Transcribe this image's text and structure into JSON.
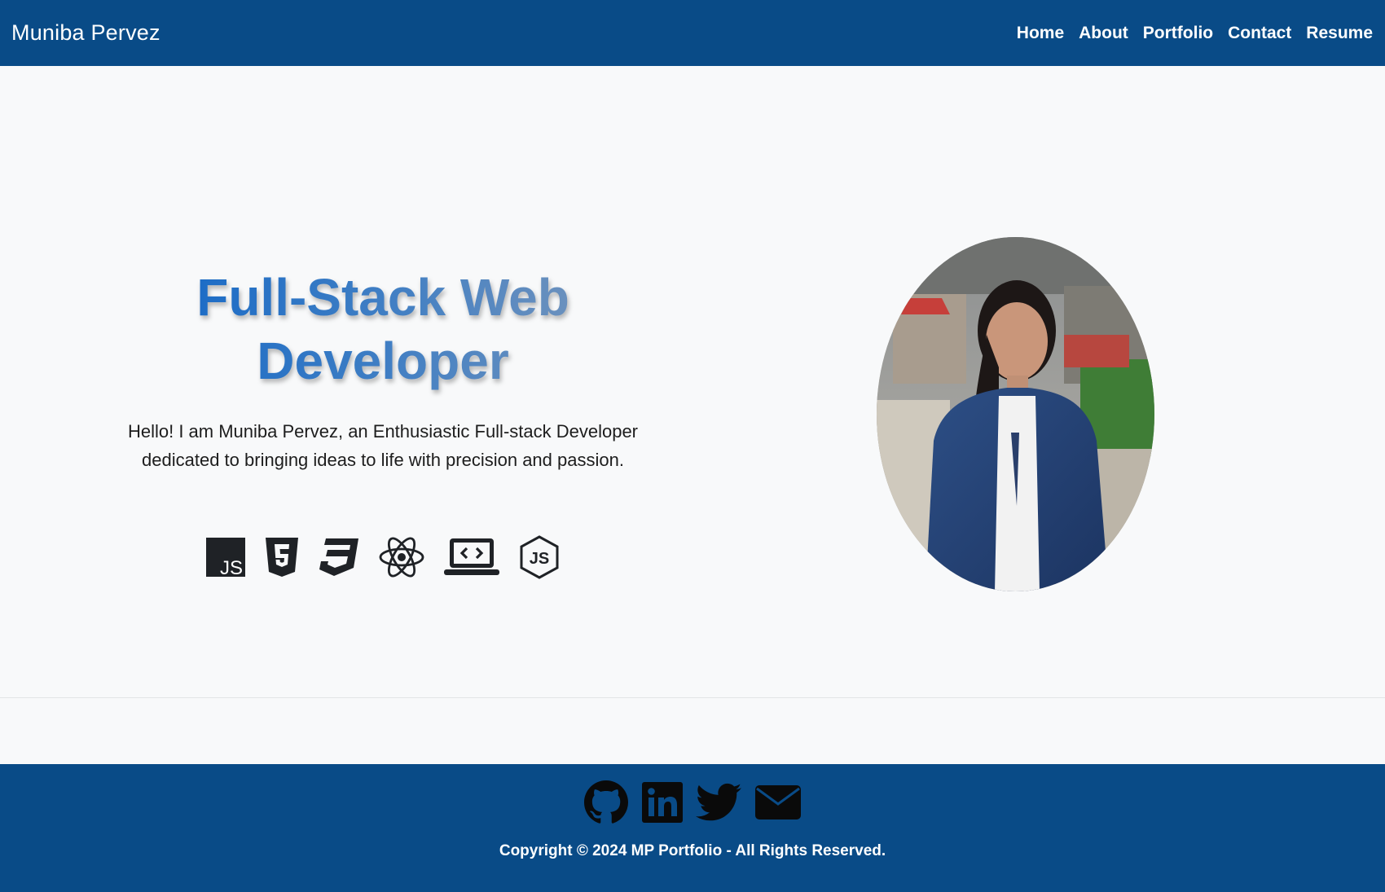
{
  "navbar": {
    "brand": "Muniba Pervez",
    "links": [
      "Home",
      "About",
      "Portfolio",
      "Contact",
      "Resume"
    ]
  },
  "hero": {
    "title": "Full-Stack Web Developer",
    "subtitle": "Hello! I am Muniba Pervez, an Enthusiastic Full-stack Developer dedicated to bringing ideas to life with precision and passion.",
    "tech_icons": [
      "javascript-icon",
      "html5-icon",
      "css3-icon",
      "react-icon",
      "laptop-code-icon",
      "nodejs-icon"
    ],
    "portrait": "profile-photo"
  },
  "footer": {
    "social_icons": [
      "github-icon",
      "linkedin-icon",
      "twitter-icon",
      "email-icon"
    ],
    "copyright": "Copyright © 2024 MP Portfolio - All Rights Reserved."
  },
  "colors": {
    "primary": "#094b87",
    "background": "#f8f9fa",
    "title_gradient_start": "#1a6bc6",
    "title_gradient_end": "#6e92bd"
  }
}
